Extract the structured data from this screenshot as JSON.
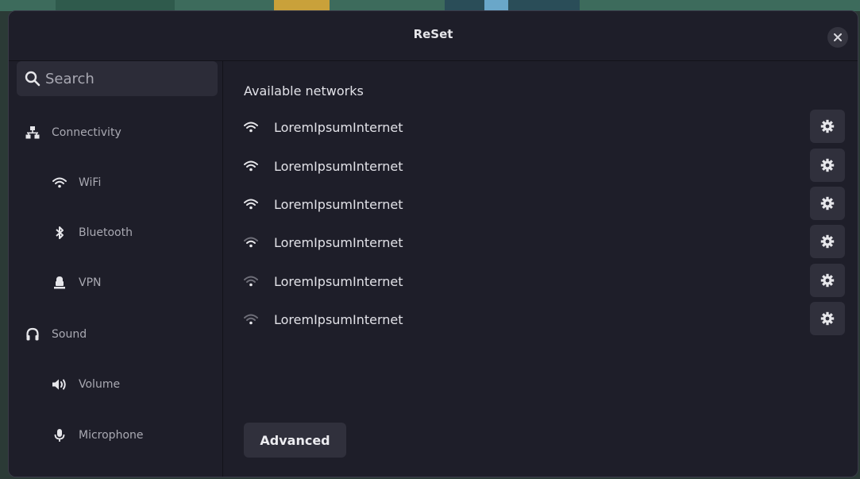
{
  "window": {
    "title": "ReSet"
  },
  "search": {
    "placeholder": "Search"
  },
  "sidebar": {
    "items": [
      {
        "label": "Connectivity",
        "icon": "network-icon"
      },
      {
        "label": "WiFi",
        "icon": "wifi-icon"
      },
      {
        "label": "Bluetooth",
        "icon": "bluetooth-icon"
      },
      {
        "label": "VPN",
        "icon": "vpn-icon"
      },
      {
        "label": "Sound",
        "icon": "headphones-icon"
      },
      {
        "label": "Volume",
        "icon": "speaker-icon"
      },
      {
        "label": "Microphone",
        "icon": "microphone-icon"
      }
    ]
  },
  "main": {
    "section_title": "Available networks",
    "networks": [
      {
        "ssid": "LoremIpsumInternet",
        "signal_bars": 3
      },
      {
        "ssid": "LoremIpsumInternet",
        "signal_bars": 3
      },
      {
        "ssid": "LoremIpsumInternet",
        "signal_bars": 3
      },
      {
        "ssid": "LoremIpsumInternet",
        "signal_bars": 2
      },
      {
        "ssid": "LoremIpsumInternet",
        "signal_bars": 1
      },
      {
        "ssid": "LoremIpsumInternet",
        "signal_bars": 1
      }
    ],
    "advanced_label": "Advanced"
  },
  "colors": {
    "window_bg": "#1e1e29",
    "button_bg": "#30303c",
    "text": "#e2e2e8",
    "muted_text": "#a9a9b2"
  }
}
